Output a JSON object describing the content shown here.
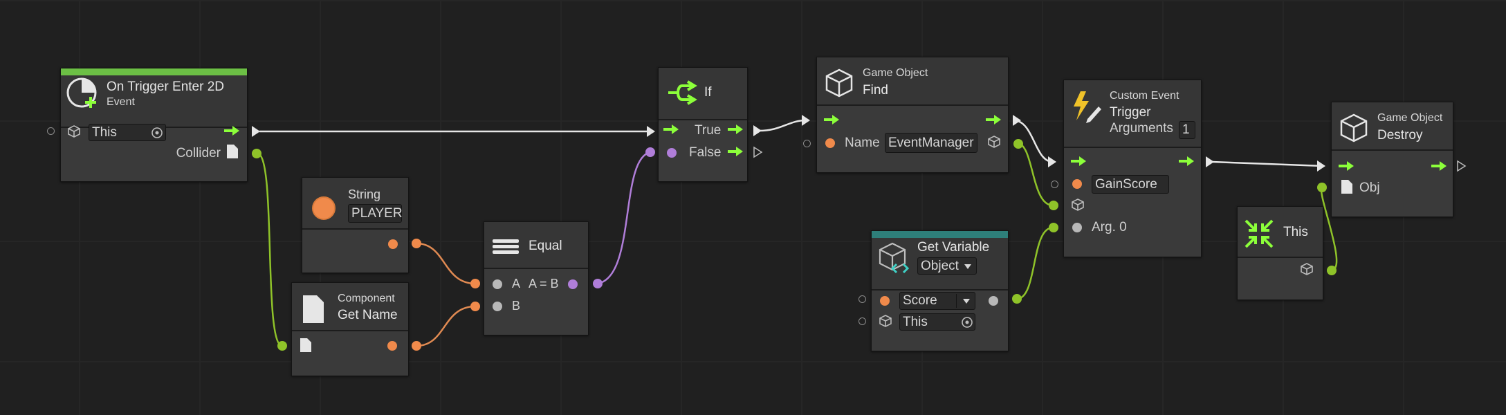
{
  "colors": {
    "flow": "#8cff3a",
    "string": "#f08a4b",
    "object": "#8fc329",
    "bool": "#b07ed9",
    "generic": "#b8b8b8",
    "event_header": "#6cbf45",
    "variable_header": "#2e7f7a"
  },
  "nodes": {
    "on_trigger": {
      "title": "On Trigger Enter 2D",
      "subtitle": "Event",
      "target_value": "This",
      "output_label": "Collider"
    },
    "string": {
      "category": "String",
      "value": "PLAYER"
    },
    "get_name": {
      "category": "Component",
      "title": "Get Name"
    },
    "equal": {
      "title": "Equal",
      "input_a": "A",
      "expression": "A = B",
      "input_b": "B"
    },
    "if": {
      "title": "If",
      "true_label": "True",
      "false_label": "False"
    },
    "find": {
      "category": "Game Object",
      "title": "Find",
      "param_label": "Name",
      "param_value": "EventManager"
    },
    "get_variable": {
      "title": "Get Variable",
      "kind": "Object",
      "name_value": "Score",
      "target_value": "This"
    },
    "custom_event": {
      "category": "Custom Event",
      "title": "Trigger",
      "arguments_label": "Arguments",
      "arguments_count": "1",
      "event_name": "GainScore",
      "arg0_label": "Arg. 0"
    },
    "this": {
      "title": "This"
    },
    "destroy": {
      "category": "Game Object",
      "title": "Destroy",
      "param_label": "Obj"
    }
  }
}
